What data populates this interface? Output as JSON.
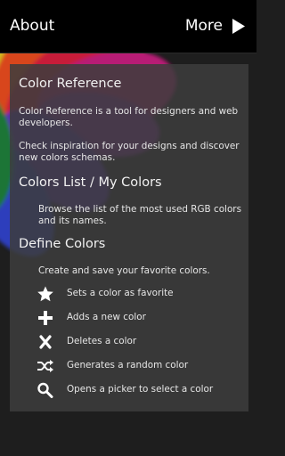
{
  "header": {
    "about_label": "About",
    "more_label": "More"
  },
  "intro": {
    "title": "Color Reference",
    "desc_line1": "Color Reference is a tool for designers and web",
    "desc_line2": "developers.",
    "inspire_line1": "Check inspiration for your designs and discover",
    "inspire_line2": "new colors schemas."
  },
  "colors_list": {
    "title": "Colors List / My Colors",
    "desc_line1": "Browse the list of the most used RGB colors",
    "desc_line2": "and its names."
  },
  "define_colors": {
    "title": "Define Colors",
    "desc": "Create and save your favorite colors.",
    "legend": [
      {
        "icon": "star-icon",
        "label": "Sets a color as favorite"
      },
      {
        "icon": "plus-icon",
        "label": "Adds a new color"
      },
      {
        "icon": "close-icon",
        "label": "Deletes a color"
      },
      {
        "icon": "shuffle-icon",
        "label": "Generates a random color"
      },
      {
        "icon": "search-icon",
        "label": "Opens a picker to select a color"
      }
    ]
  },
  "colors": {
    "panel_bg": "#3c3c3c",
    "text": "#e6e6e6",
    "top_bar": "#000000"
  }
}
